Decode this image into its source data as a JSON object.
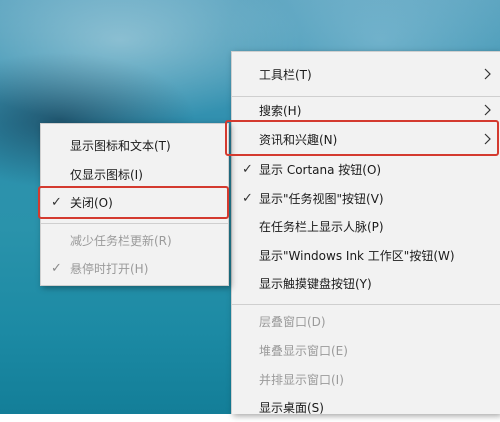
{
  "main_menu": {
    "items": [
      {
        "label": "工具栏(T)",
        "checked": false,
        "disabled": false,
        "submenu": true
      },
      {
        "label": "搜索(H)",
        "checked": false,
        "disabled": false,
        "submenu": true
      },
      {
        "label": "资讯和兴趣(N)",
        "checked": false,
        "disabled": false,
        "submenu": true,
        "highlighted": true
      },
      {
        "label": "显示 Cortana 按钮(O)",
        "checked": true,
        "disabled": false
      },
      {
        "label": "显示\"任务视图\"按钮(V)",
        "checked": true,
        "disabled": false
      },
      {
        "label": "在任务栏上显示人脉(P)",
        "checked": false,
        "disabled": false
      },
      {
        "label": "显示\"Windows Ink 工作区\"按钮(W)",
        "checked": false,
        "disabled": false
      },
      {
        "label": "显示触摸键盘按钮(Y)",
        "checked": false,
        "disabled": false
      },
      {
        "label": "层叠窗口(D)",
        "checked": false,
        "disabled": true
      },
      {
        "label": "堆叠显示窗口(E)",
        "checked": false,
        "disabled": true
      },
      {
        "label": "并排显示窗口(I)",
        "checked": false,
        "disabled": true
      },
      {
        "label": "显示桌面(S)",
        "checked": false,
        "disabled": false
      }
    ]
  },
  "sub_menu": {
    "items": [
      {
        "label": "显示图标和文本(T)",
        "checked": false,
        "disabled": false
      },
      {
        "label": "仅显示图标(I)",
        "checked": false,
        "disabled": false
      },
      {
        "label": "关闭(O)",
        "checked": true,
        "disabled": false,
        "highlighted": true
      },
      {
        "label": "减少任务栏更新(R)",
        "checked": false,
        "disabled": true
      },
      {
        "label": "悬停时打开(H)",
        "checked": true,
        "disabled": true
      }
    ]
  },
  "icons": {
    "check": "✓",
    "submenu_arrow": "chevron-right-icon"
  },
  "colors": {
    "highlight_border": "#d43a2f",
    "menu_background": "#f2f2f2"
  }
}
